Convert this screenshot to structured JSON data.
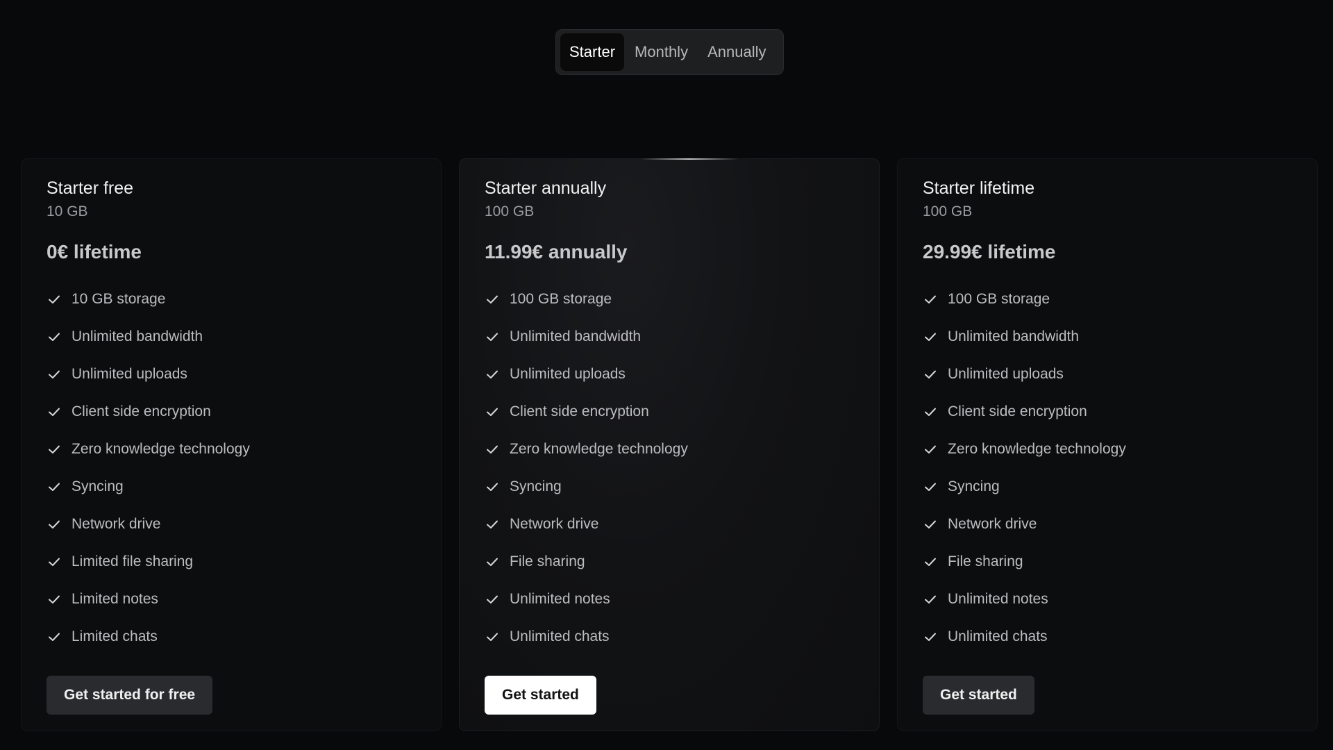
{
  "tabs": [
    {
      "label": "Starter",
      "active": true
    },
    {
      "label": "Monthly",
      "active": false
    },
    {
      "label": "Annually",
      "active": false
    }
  ],
  "plans": [
    {
      "name": "Starter free",
      "size": "10 GB",
      "price": "0€ lifetime",
      "features": [
        "10 GB storage",
        "Unlimited bandwidth",
        "Unlimited uploads",
        "Client side encryption",
        "Zero knowledge technology",
        "Syncing",
        "Network drive",
        "Limited file sharing",
        "Limited notes",
        "Limited chats"
      ],
      "cta": "Get started for free",
      "cta_style": "dark"
    },
    {
      "name": "Starter annually",
      "size": "100 GB",
      "price": "11.99€ annually",
      "features": [
        "100 GB storage",
        "Unlimited bandwidth",
        "Unlimited uploads",
        "Client side encryption",
        "Zero knowledge technology",
        "Syncing",
        "Network drive",
        "File sharing",
        "Unlimited notes",
        "Unlimited chats"
      ],
      "cta": "Get started",
      "cta_style": "light",
      "highlighted": true
    },
    {
      "name": "Starter lifetime",
      "size": "100 GB",
      "price": "29.99€ lifetime",
      "features": [
        "100 GB storage",
        "Unlimited bandwidth",
        "Unlimited uploads",
        "Client side encryption",
        "Zero knowledge technology",
        "Syncing",
        "Network drive",
        "File sharing",
        "Unlimited notes",
        "Unlimited chats"
      ],
      "cta": "Get started",
      "cta_style": "dark"
    }
  ],
  "icons": {
    "feature": "check-icon"
  },
  "colors": {
    "background": "#08090b",
    "card": "#0c0d0f",
    "accent_button": "#ffffff",
    "dark_button": "#2a2b2e"
  }
}
